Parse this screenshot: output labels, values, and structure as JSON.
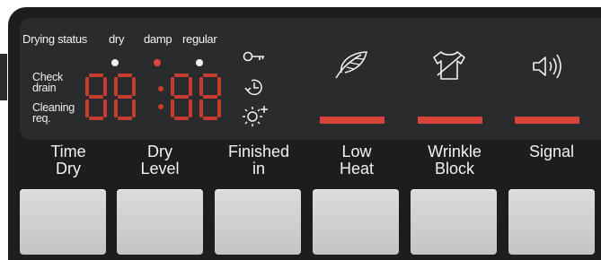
{
  "drying_status": {
    "title": "Drying status",
    "options": [
      {
        "label": "dry",
        "active": false
      },
      {
        "label": "damp",
        "active": true
      },
      {
        "label": "regular",
        "active": false
      }
    ]
  },
  "indicators": {
    "check_drain": "Check\ndrain",
    "cleaning_req": "Cleaning\nreq."
  },
  "timer_display": "88:88",
  "status_icons": [
    "key-lock-icon",
    "delay-timer-icon",
    "brightness-plus-icon"
  ],
  "function_icons": [
    "feather-icon",
    "shirt-icon",
    "speaker-icon"
  ],
  "buttons": [
    {
      "label": "Time\nDry"
    },
    {
      "label": "Dry\nLevel"
    },
    {
      "label": "Finished\nin"
    },
    {
      "label": "Low\nHeat"
    },
    {
      "label": "Wrinkle\nBlock"
    },
    {
      "label": "Signal"
    }
  ],
  "colors": {
    "panel": "#1c1d1f",
    "display": "#2a2b2d",
    "segment_red": "#c83c30",
    "indicator_red": "#d9443a",
    "key_grey": "#d2d2d2"
  }
}
